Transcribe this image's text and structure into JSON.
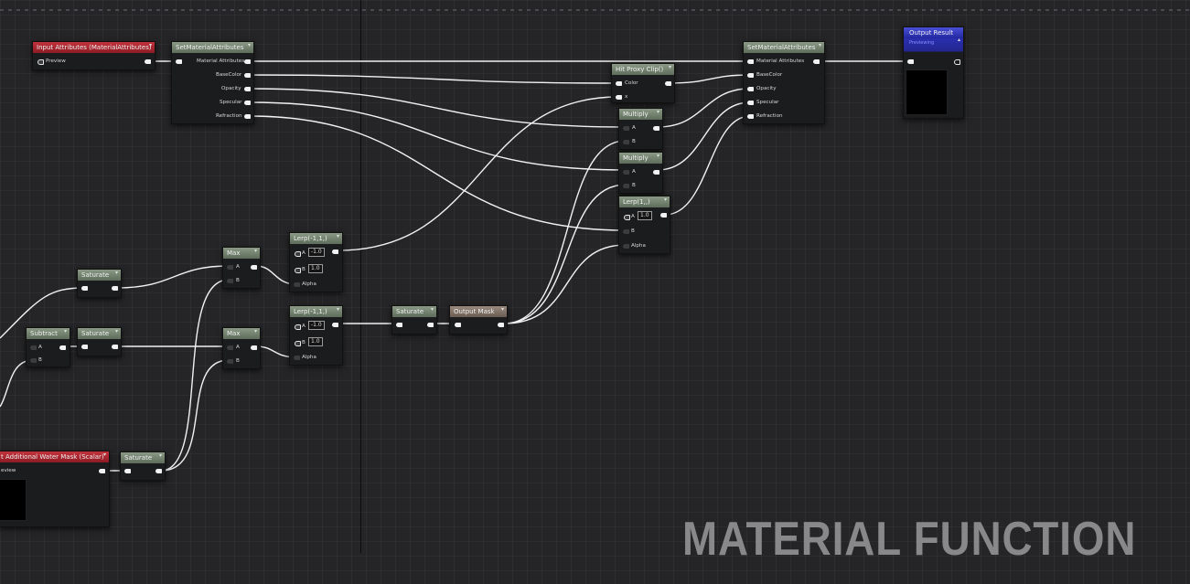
{
  "nodes": {
    "input_attributes": {
      "title": "Input Attributes (MaterialAttributes)",
      "pins": [
        "Preview"
      ]
    },
    "set_material_attributes_1": {
      "title": "SetMaterialAttributes",
      "pins": [
        "Material Attributes",
        "BaseColor",
        "Opacity",
        "Specular",
        "Refraction"
      ]
    },
    "saturate_top": {
      "title": "Saturate"
    },
    "subtract": {
      "title": "Subtract",
      "pins": [
        "A",
        "B"
      ]
    },
    "saturate_mid": {
      "title": "Saturate"
    },
    "max_top": {
      "title": "Max",
      "pins": [
        "A",
        "B"
      ]
    },
    "max_bottom": {
      "title": "Max",
      "pins": [
        "A",
        "B"
      ]
    },
    "lerp_top": {
      "title": "Lerp(-1,1,)",
      "pins": [
        "A",
        "B",
        "Alpha"
      ],
      "a_value": "-1.0",
      "b_value": "1.0"
    },
    "lerp_bottom": {
      "title": "Lerp(-1,1,)",
      "pins": [
        "A",
        "B",
        "Alpha"
      ],
      "a_value": "-1.0",
      "b_value": "1.0"
    },
    "water_mask": {
      "title": "t Additional Water Mask (Scalar)",
      "pins": [
        "eview"
      ]
    },
    "saturate_bottom": {
      "title": "Saturate"
    },
    "saturate_center": {
      "title": "Saturate"
    },
    "output_mask": {
      "title": "Output Mask"
    },
    "hit_proxy_clip": {
      "title": "Hit Proxy Clip()",
      "pins": [
        "Color",
        "x"
      ]
    },
    "multiply_1": {
      "title": "Multiply",
      "pins": [
        "A",
        "B"
      ]
    },
    "multiply_2": {
      "title": "Multiply",
      "pins": [
        "A",
        "B"
      ]
    },
    "lerp_right": {
      "title": "Lerp(1,,)",
      "pins": [
        "A",
        "B",
        "Alpha"
      ],
      "a_value": "1.0"
    },
    "set_material_attributes_2": {
      "title": "SetMaterialAttributes",
      "pins": [
        "Material Attributes",
        "BaseColor",
        "Opacity",
        "Specular",
        "Refraction"
      ]
    },
    "output_result": {
      "title": "Output Result",
      "subtitle": "Previewing"
    }
  },
  "watermark": "MATERIAL FUNCTION",
  "colors": {
    "background": "#252527",
    "node_header_gray": "#6f7d6b",
    "node_header_red": "#a8252e",
    "node_header_blue": "#2e33c0",
    "wire": "#f2f2f2"
  }
}
